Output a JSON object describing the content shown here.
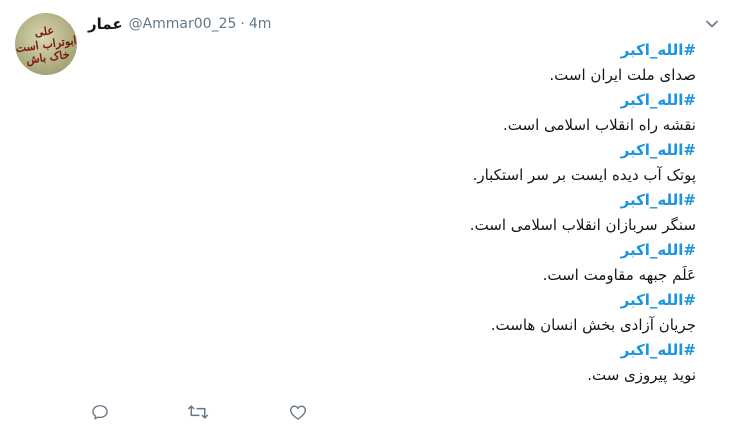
{
  "author": {
    "display_name": "عمار",
    "handle": "@Ammar00_25",
    "separator": "·",
    "time": "4m",
    "avatar_text": [
      "علی",
      "ابوتراب است",
      "خاک باش"
    ]
  },
  "tweet": {
    "hashtag": "#الله_اکبر",
    "lines": [
      "صدای ملت ایران است.",
      "نقشه راه انقلاب اسلامی است.",
      "پوتک آب دیده ایست بر سر استکبار.",
      "سنگر سربازان انقلاب اسلامی است.",
      "عَلَم جبهه مقاومت است.",
      "جریان آزادی بخش انسان هاست.",
      "نوید پیروزی ست."
    ]
  },
  "actions": {
    "reply_icon": "reply-icon",
    "retweet_icon": "retweet-icon",
    "like_icon": "like-icon"
  },
  "colors": {
    "hashtag": "#1b95e0",
    "text": "#14171a",
    "muted": "#657786"
  }
}
